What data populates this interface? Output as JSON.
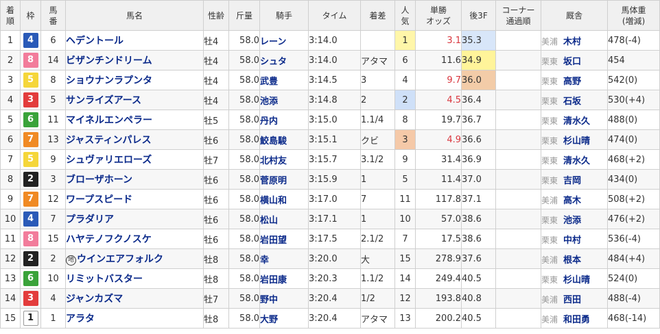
{
  "headers": {
    "rank": "着順",
    "waku": "枠",
    "umaban": "馬番",
    "horse": "馬名",
    "sexage": "性齢",
    "weight": "斤量",
    "jockey": "騎手",
    "time": "タイム",
    "margin": "着差",
    "popularity": "人気",
    "odds": "単勝オッズ",
    "last3f": "後3F",
    "corner": "コーナー通過順",
    "trainer": "厩舎",
    "body_weight": "馬体重(増減)"
  },
  "rows": [
    {
      "rank": "1",
      "waku": "4",
      "umaban": "6",
      "horse": "ヘデントール",
      "sexage": "牡4",
      "weight": "58.0",
      "jockey": "レーン",
      "time": "3:14.0",
      "margin": "",
      "popularity": "1",
      "odds": "3.1",
      "last3f": "35.3",
      "corner": "",
      "region": "美浦",
      "trainer": "木村",
      "body_weight": "478(-4)"
    },
    {
      "rank": "2",
      "waku": "8",
      "umaban": "14",
      "horse": "ビザンチンドリーム",
      "sexage": "牡4",
      "weight": "58.0",
      "jockey": "シュタ",
      "time": "3:14.0",
      "margin": "アタマ",
      "popularity": "6",
      "odds": "11.6",
      "last3f": "34.9",
      "corner": "",
      "region": "栗東",
      "trainer": "坂口",
      "body_weight": "454"
    },
    {
      "rank": "3",
      "waku": "5",
      "umaban": "8",
      "horse": "ショウナンラプンタ",
      "sexage": "牡4",
      "weight": "58.0",
      "jockey": "武豊",
      "time": "3:14.5",
      "margin": "3",
      "popularity": "4",
      "odds": "9.7",
      "last3f": "36.0",
      "corner": "",
      "region": "栗東",
      "trainer": "高野",
      "body_weight": "542(0)"
    },
    {
      "rank": "4",
      "waku": "3",
      "umaban": "5",
      "horse": "サンライズアース",
      "sexage": "牡4",
      "weight": "58.0",
      "jockey": "池添",
      "time": "3:14.8",
      "margin": "2",
      "popularity": "2",
      "odds": "4.5",
      "last3f": "36.4",
      "corner": "",
      "region": "栗東",
      "trainer": "石坂",
      "body_weight": "530(+4)"
    },
    {
      "rank": "5",
      "waku": "6",
      "umaban": "11",
      "horse": "マイネルエンペラー",
      "sexage": "牡5",
      "weight": "58.0",
      "jockey": "丹内",
      "time": "3:15.0",
      "margin": "1.1/4",
      "popularity": "8",
      "odds": "19.7",
      "last3f": "36.7",
      "corner": "",
      "region": "栗東",
      "trainer": "清水久",
      "body_weight": "488(0)"
    },
    {
      "rank": "6",
      "waku": "7",
      "umaban": "13",
      "horse": "ジャスティンパレス",
      "sexage": "牡6",
      "weight": "58.0",
      "jockey": "鮫島駿",
      "time": "3:15.1",
      "margin": "クビ",
      "popularity": "3",
      "odds": "4.9",
      "last3f": "36.6",
      "corner": "",
      "region": "栗東",
      "trainer": "杉山晴",
      "body_weight": "474(0)"
    },
    {
      "rank": "7",
      "waku": "5",
      "umaban": "9",
      "horse": "シュヴァリエローズ",
      "sexage": "牡7",
      "weight": "58.0",
      "jockey": "北村友",
      "time": "3:15.7",
      "margin": "3.1/2",
      "popularity": "9",
      "odds": "31.4",
      "last3f": "36.9",
      "corner": "",
      "region": "栗東",
      "trainer": "清水久",
      "body_weight": "468(+2)"
    },
    {
      "rank": "8",
      "waku": "2",
      "umaban": "3",
      "horse": "ブローザホーン",
      "sexage": "牡6",
      "weight": "58.0",
      "jockey": "菅原明",
      "time": "3:15.9",
      "margin": "1",
      "popularity": "5",
      "odds": "11.4",
      "last3f": "37.0",
      "corner": "",
      "region": "栗東",
      "trainer": "吉岡",
      "body_weight": "434(0)"
    },
    {
      "rank": "9",
      "waku": "7",
      "umaban": "12",
      "horse": "ワープスピード",
      "sexage": "牡6",
      "weight": "58.0",
      "jockey": "横山和",
      "time": "3:17.0",
      "margin": "7",
      "popularity": "11",
      "odds": "117.8",
      "last3f": "37.1",
      "corner": "",
      "region": "美浦",
      "trainer": "高木",
      "body_weight": "508(+2)"
    },
    {
      "rank": "10",
      "waku": "4",
      "umaban": "7",
      "horse": "プラダリア",
      "sexage": "牡6",
      "weight": "58.0",
      "jockey": "松山",
      "time": "3:17.1",
      "margin": "1",
      "popularity": "10",
      "odds": "57.0",
      "last3f": "38.6",
      "corner": "",
      "region": "栗東",
      "trainer": "池添",
      "body_weight": "476(+2)"
    },
    {
      "rank": "11",
      "waku": "8",
      "umaban": "15",
      "horse": "ハヤテノフクノスケ",
      "sexage": "牡6",
      "weight": "58.0",
      "jockey": "岩田望",
      "time": "3:17.5",
      "margin": "2.1/2",
      "popularity": "7",
      "odds": "17.5",
      "last3f": "38.6",
      "corner": "",
      "region": "栗東",
      "trainer": "中村",
      "body_weight": "536(-4)"
    },
    {
      "rank": "12",
      "waku": "2",
      "umaban": "2",
      "horse": "ウインエアフォルク",
      "chi": "地",
      "sexage": "牡8",
      "weight": "58.0",
      "jockey": "幸",
      "time": "3:20.0",
      "margin": "大",
      "popularity": "15",
      "odds": "278.9",
      "last3f": "37.6",
      "corner": "",
      "region": "美浦",
      "trainer": "根本",
      "body_weight": "484(+4)"
    },
    {
      "rank": "13",
      "waku": "6",
      "umaban": "10",
      "horse": "リミットバスター",
      "sexage": "牡8",
      "weight": "58.0",
      "jockey": "岩田康",
      "time": "3:20.3",
      "margin": "1.1/2",
      "popularity": "14",
      "odds": "249.4",
      "last3f": "40.5",
      "corner": "",
      "region": "栗東",
      "trainer": "杉山晴",
      "body_weight": "524(0)"
    },
    {
      "rank": "14",
      "waku": "3",
      "umaban": "4",
      "horse": "ジャンカズマ",
      "sexage": "牡7",
      "weight": "58.0",
      "jockey": "野中",
      "time": "3:20.4",
      "margin": "1/2",
      "popularity": "12",
      "odds": "193.8",
      "last3f": "40.8",
      "corner": "",
      "region": "美浦",
      "trainer": "西田",
      "body_weight": "488(-4)"
    },
    {
      "rank": "15",
      "waku": "1",
      "umaban": "1",
      "horse": "アラタ",
      "sexage": "牡8",
      "weight": "58.0",
      "jockey": "大野",
      "time": "3:20.4",
      "margin": "アタマ",
      "popularity": "13",
      "odds": "200.2",
      "last3f": "40.5",
      "corner": "",
      "region": "美浦",
      "trainer": "和田勇",
      "body_weight": "468(-14)"
    }
  ],
  "colors": {
    "waku": {
      "1": "#ffffff",
      "2": "#222222",
      "3": "#e33c3c",
      "4": "#2a5ab8",
      "5": "#f5d63a",
      "6": "#3aa33a",
      "7": "#f08a24",
      "8": "#f27c9b"
    },
    "link": "#0b2a8a",
    "odds_hot": "#d9363e"
  }
}
